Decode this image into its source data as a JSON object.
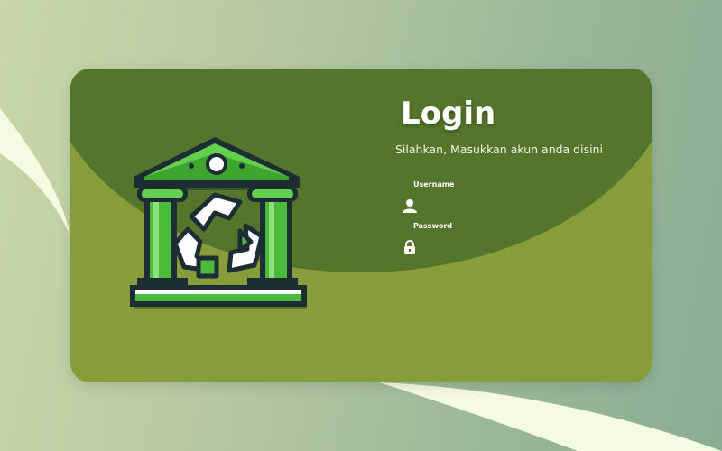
{
  "login": {
    "title": "Login",
    "subtitle": "Silahkan, Masukkan akun anda disini",
    "username_label": "Username",
    "password_label": "Password",
    "username_value": "",
    "password_value": ""
  },
  "icons": {
    "username": "user-icon",
    "password": "lock-icon",
    "logo": "recycle-bank-building-logo"
  },
  "colors": {
    "card_top": "#55752c",
    "card_bottom": "#869d3a",
    "accent_green": "#4cbb3b"
  }
}
